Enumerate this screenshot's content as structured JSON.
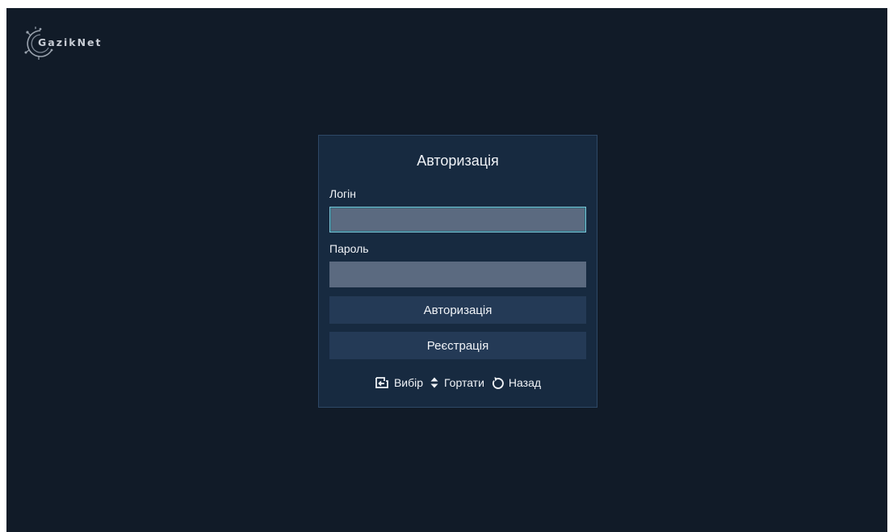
{
  "logo": {
    "text": "GazikNet"
  },
  "auth": {
    "title": "Авторизація",
    "login_label": "Логін",
    "login_value": "",
    "password_label": "Пароль",
    "password_value": "",
    "login_button": "Авторизація",
    "register_button": "Реєстрація"
  },
  "hints": {
    "select": "Вибір",
    "scroll": "Гортати",
    "back": "Назад"
  },
  "colors": {
    "background": "#111b28",
    "panel": "#172a40",
    "input": "#5b6a80",
    "button": "#243a56",
    "focus": "#7ec3d6"
  }
}
